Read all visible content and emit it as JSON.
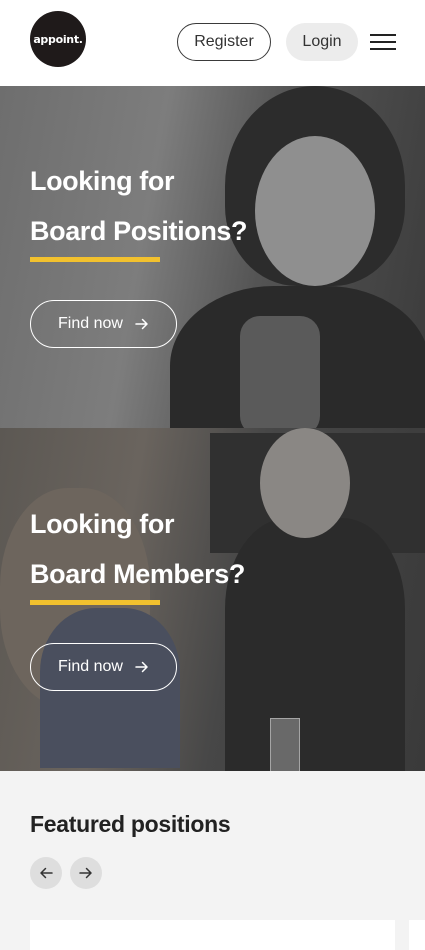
{
  "header": {
    "logo_text": "appoint.",
    "register_label": "Register",
    "login_label": "Login",
    "menu_icon": "hamburger-menu-icon"
  },
  "hero_positions": {
    "line1": "Looking for",
    "line2": "Board Positions?",
    "button_label": "Find now",
    "button_icon": "arrow-right-icon",
    "accent_color": "#f2c12e"
  },
  "hero_members": {
    "line1": "Looking for",
    "line2": "Board Members?",
    "button_label": "Find now",
    "button_icon": "arrow-right-icon",
    "accent_color": "#f2c12e"
  },
  "featured": {
    "title": "Featured positions",
    "prev_icon": "arrow-left-icon",
    "next_icon": "arrow-right-icon"
  }
}
